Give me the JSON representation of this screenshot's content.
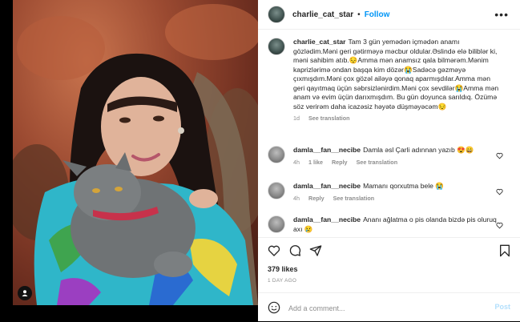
{
  "header": {
    "username": "charlie_cat_star",
    "separator": "•",
    "follow_label": "Follow",
    "more_label": "•••"
  },
  "caption": {
    "username": "charlie_cat_star",
    "text": "Tam 3 gün yemədən içmədən anamı gözlədim.Məni geri gətirməyə məcbur oldular.Əslində elə biliblər ki, məni sahibim atıb.😔Amma mən anamsız qala bilmərəm.Mənim kaprizlərimə ondan başqa kim dözər😭Sadəcə gəzməyə çıxmışdım.Məni çox gözəl ailəyə qonaq aparmışdılar.Amma mən geri qayıtmaq üçün səbrsizlənirdim.Məni çox sevdilər😭Amma mən anam və evim üçün darıxmışdım. Bu gün doyunca sarıldıq. Özümə söz verirəm daha icazəsiz həyətə düşməyəcəm😔",
    "time": "1d",
    "see_translation": "See translation"
  },
  "comments": [
    {
      "username": "damla__fan__necibe",
      "text": "Damla əsl Çarli adınnan yazıb 😍😄",
      "time": "4h",
      "likes": "1 like",
      "reply": "Reply",
      "see_translation": "See translation"
    },
    {
      "username": "damla__fan__necibe",
      "text": "Mamanı qorxutma bele 😭",
      "time": "4h",
      "reply": "Reply",
      "see_translation": "See translation"
    },
    {
      "username": "damla__fan__necibe",
      "text": "Ananı ağlatma o pis olanda bizdə pis oluruq axı 😢",
      "time": "",
      "reply": "",
      "see_translation": ""
    }
  ],
  "stats": {
    "likes": "379 likes",
    "time_ago": "1 DAY AGO"
  },
  "add_comment": {
    "placeholder": "Add a comment...",
    "post_label": "Post"
  },
  "colors": {
    "accent": "#0095f6",
    "post_disabled": "#b2dffc",
    "text": "#262626",
    "muted": "#8e8e8e"
  }
}
